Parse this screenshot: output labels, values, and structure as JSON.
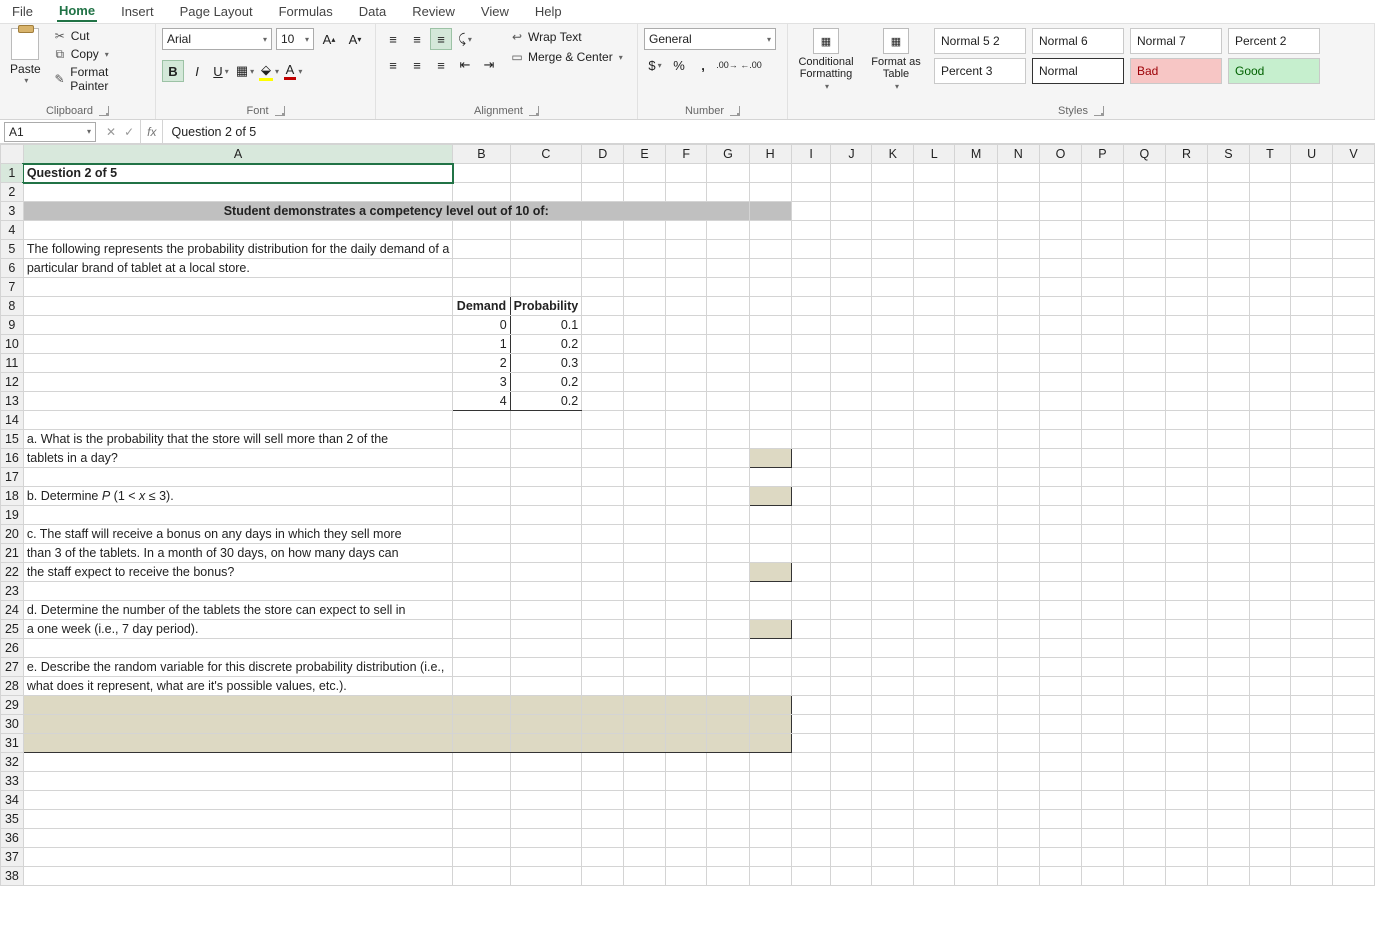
{
  "tabs": {
    "file": "File",
    "home": "Home",
    "insert": "Insert",
    "page_layout": "Page Layout",
    "formulas": "Formulas",
    "data": "Data",
    "review": "Review",
    "view": "View",
    "help": "Help"
  },
  "clipboard": {
    "paste": "Paste",
    "cut": "Cut",
    "copy": "Copy",
    "format_painter": "Format Painter",
    "label": "Clipboard"
  },
  "font": {
    "name": "Arial",
    "size": "10",
    "label": "Font"
  },
  "alignment": {
    "wrap": "Wrap Text",
    "merge": "Merge & Center",
    "label": "Alignment"
  },
  "number": {
    "format": "General",
    "label": "Number"
  },
  "styles": {
    "cond": "Conditional Formatting",
    "fat": "Format as Table",
    "label": "Styles",
    "cells": [
      "Normal 5 2",
      "Normal 6",
      "Normal 7",
      "Percent 2",
      "Percent 3",
      "Normal",
      "Bad",
      "Good"
    ]
  },
  "fbar": {
    "ref": "A1",
    "formula": "Question 2 of 5"
  },
  "columns": [
    "A",
    "B",
    "C",
    "D",
    "E",
    "F",
    "G",
    "H",
    "I",
    "J",
    "K",
    "L",
    "M",
    "N",
    "O",
    "P",
    "Q",
    "R",
    "S",
    "T",
    "U",
    "V"
  ],
  "cells": {
    "r1": {
      "A": "Question 2 of 5"
    },
    "r3": {
      "merge": "Student demonstrates a competency level out of 10 of:"
    },
    "r5": {
      "A": "The following represents the probability distribution for the daily demand of a"
    },
    "r6": {
      "A": "particular brand of tablet at a local store."
    },
    "r8": {
      "B": "Demand",
      "C": "Probability"
    },
    "r9": {
      "B": "0",
      "C": "0.1"
    },
    "r10": {
      "B": "1",
      "C": "0.2"
    },
    "r11": {
      "B": "2",
      "C": "0.3"
    },
    "r12": {
      "B": "3",
      "C": "0.2"
    },
    "r13": {
      "B": "4",
      "C": "0.2"
    },
    "r15": {
      "A": "a. What is the probability that the store will sell more than 2 of the"
    },
    "r16": {
      "A": "tablets in a day?"
    },
    "r18": {
      "A": "b. Determine P (1 < x ≤ 3)."
    },
    "r20": {
      "A": "c. The staff will receive a bonus on any days in which they sell more"
    },
    "r21": {
      "A": "than 3 of the tablets. In a month of 30 days, on how many days can"
    },
    "r22": {
      "A": "the staff expect to receive the bonus?"
    },
    "r24": {
      "A": "d. Determine the number of the tablets the store can expect to sell in"
    },
    "r25": {
      "A": "a one week (i.e., 7 day period)."
    },
    "r27": {
      "A": "e. Describe the random variable for this discrete probability distribution (i.e.,"
    },
    "r28": {
      "A": "what does it represent, what are it's possible values, etc.)."
    }
  }
}
